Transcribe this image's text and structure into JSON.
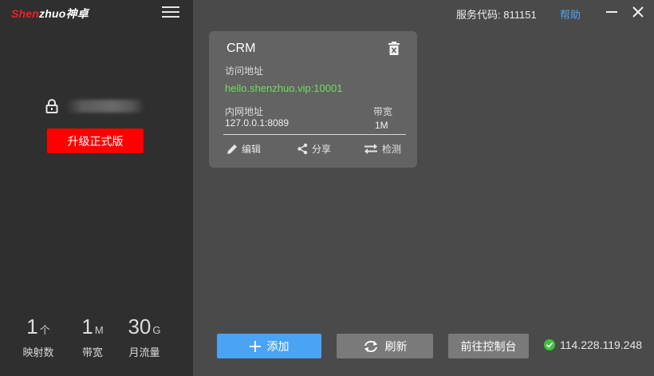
{
  "sidebar": {
    "logo": {
      "brand_prefix": "Shen",
      "brand_suffix": "zhuo",
      "brand_cn": "神卓"
    },
    "upgrade_label": "升级正式版",
    "stats": [
      {
        "value": "1",
        "unit": "个",
        "label": "映射数"
      },
      {
        "value": "1",
        "unit": "M",
        "label": "带宽"
      },
      {
        "value": "30",
        "unit": "G",
        "label": "月流量"
      }
    ]
  },
  "topbar": {
    "service_code_label": "服务代码:",
    "service_code": "811151",
    "help_label": "帮助"
  },
  "card": {
    "title": "CRM",
    "access_label": "访问地址",
    "public_url": "hello.shenzhuo.vip:10001",
    "intranet_label": "内网地址",
    "intranet_address": "127.0.0.1:8089",
    "bandwidth_label": "带宽",
    "bandwidth_value": "1M",
    "actions": {
      "edit": "编辑",
      "share": "分享",
      "test": "检测"
    }
  },
  "bottom": {
    "add_label": "添加",
    "refresh_label": "刷新",
    "console_label": "前往控制台",
    "ip_address": "114.228.119.248"
  },
  "colors": {
    "accent_blue": "#4ba3f3",
    "upgrade_red": "#ff0000",
    "url_green": "#6ee05a",
    "status_green": "#3cc43c"
  }
}
